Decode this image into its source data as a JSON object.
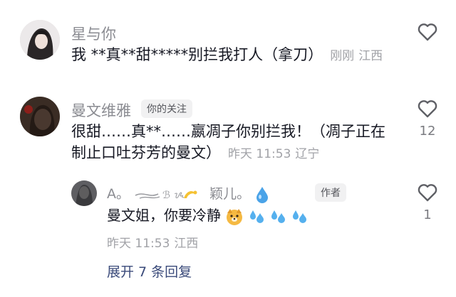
{
  "comments": [
    {
      "username": "星与你",
      "content": "我 **真**甜*****别拦我打人（拿刀）",
      "time": "刚刚",
      "location": "江西",
      "likes": ""
    },
    {
      "username": "曼文维雅",
      "badge": "你的关注",
      "content_line1": "很甜……真**……嬴凋子你别拦我！（凋子正在",
      "content_line2": "制止口吐芬芳的曼文）",
      "time": "昨天 11:53",
      "location": "辽宁",
      "likes": "12"
    }
  ],
  "reply": {
    "username_text": "A。",
    "username_suffix": "颖儿。",
    "badge": "作者",
    "content": "曼文姐，你要冷静",
    "time": "昨天 11:53",
    "location": "江西",
    "likes": "1"
  },
  "expand_label": "展开 7 条回复",
  "icons": {
    "heart": "heart-outline-icon"
  }
}
